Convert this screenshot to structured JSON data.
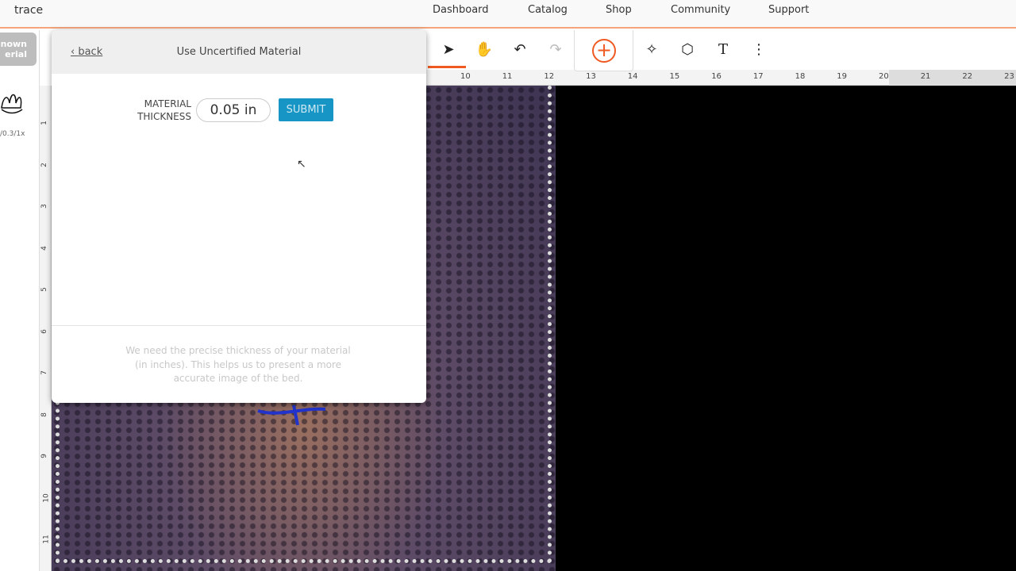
{
  "topbar": {
    "app_name": "trace",
    "nav": [
      "Dashboard",
      "Catalog",
      "Shop",
      "Community",
      "Support"
    ]
  },
  "sidebar": {
    "material_button": "nown\nerial",
    "scale_text": "/0.3/1x"
  },
  "toolbar": {
    "icons": [
      "select-arrow-icon",
      "hand-pan-icon",
      "undo-icon",
      "redo-icon",
      "add-circle-icon",
      "trace-magic-icon",
      "shapes-icon",
      "text-icon",
      "more-vertical-icon"
    ],
    "accent": "#f05a22"
  },
  "ruler": {
    "horizontal": [
      "10",
      "11",
      "12",
      "13",
      "14",
      "15",
      "16",
      "17",
      "18",
      "19",
      "20",
      "21",
      "22",
      "23"
    ],
    "vertical": [
      "1",
      "2",
      "3",
      "4",
      "5",
      "6",
      "7",
      "8",
      "9",
      "10",
      "11"
    ]
  },
  "modal": {
    "back_label": "back",
    "title": "Use Uncertified Material",
    "field_label_line1": "MATERIAL",
    "field_label_line2": "THICKNESS",
    "thickness_value": "0.05 in",
    "submit_label": "SUBMIT",
    "help_text": "We need the precise thickness of your material (in inches). This helps us to present a more accurate image of the bed.",
    "submit_color": "#1795c4"
  }
}
